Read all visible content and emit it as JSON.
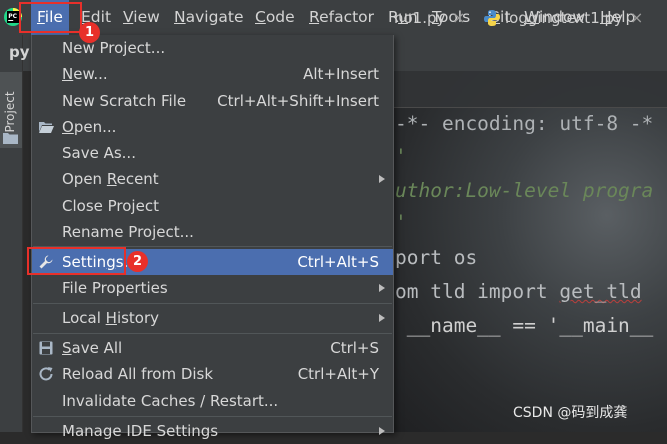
{
  "menubar": {
    "items": [
      {
        "pre": "",
        "mn": "F",
        "post": "ile"
      },
      {
        "pre": "",
        "mn": "E",
        "post": "dit"
      },
      {
        "pre": "",
        "mn": "V",
        "post": "iew"
      },
      {
        "pre": "",
        "mn": "N",
        "post": "avigate"
      },
      {
        "pre": "",
        "mn": "C",
        "post": "ode"
      },
      {
        "pre": "",
        "mn": "R",
        "post": "efactor"
      },
      {
        "pre": "R",
        "mn": "u",
        "post": "n"
      },
      {
        "pre": "",
        "mn": "T",
        "post": "ools"
      },
      {
        "pre": "",
        "mn": "G",
        "post": "it"
      },
      {
        "pre": "",
        "mn": "W",
        "post": "indow"
      },
      {
        "pre": "",
        "mn": "H",
        "post": "elp"
      }
    ]
  },
  "sidebar": {
    "project_label": "Project",
    "title_fragment": "py"
  },
  "editor": {
    "tabs": [
      {
        "label": "no1.py"
      },
      {
        "label": "loggingtext1.py"
      }
    ],
    "code": [
      {
        "a": "-*- encoding: utf-8 -*"
      },
      {
        "a": "'"
      },
      {
        "a": "uthor:Low-level progra"
      },
      {
        "a": "'"
      },
      {
        "a": "port os"
      },
      {
        "a": "om tld import ",
        "b": "get_tld"
      },
      {
        "a": " __name__ == '__main__"
      }
    ]
  },
  "file_menu": {
    "items": [
      {
        "pre": "New Project...",
        "mn": "",
        "post": "",
        "shortcut": ""
      },
      {
        "pre": "",
        "mn": "N",
        "post": "ew...",
        "shortcut": "Alt+Insert"
      },
      {
        "pre": "New Scratch File",
        "mn": "",
        "post": "",
        "shortcut": "Ctrl+Alt+Shift+Insert"
      },
      {
        "pre": "",
        "mn": "O",
        "post": "pen...",
        "shortcut": "",
        "icon": "folder-open-icon"
      },
      {
        "pre": "Save As...",
        "mn": "",
        "post": "",
        "shortcut": ""
      },
      {
        "pre": "Open ",
        "mn": "R",
        "post": "ecent",
        "shortcut": "",
        "submenu": true
      },
      {
        "pre": "Close Project",
        "mn": "",
        "post": "",
        "shortcut": ""
      },
      {
        "pre": "Rename Project...",
        "mn": "",
        "post": "",
        "shortcut": ""
      },
      {
        "pre": "Settin",
        "mn": "g",
        "post": "s...",
        "shortcut": "Ctrl+Alt+S",
        "icon": "wrench-icon",
        "highlighted": true
      },
      {
        "pre": "File Properties",
        "mn": "",
        "post": "",
        "shortcut": "",
        "submenu": true
      },
      {
        "pre": "Local ",
        "mn": "H",
        "post": "istory",
        "shortcut": "",
        "submenu": true
      },
      {
        "pre": "",
        "mn": "S",
        "post": "ave All",
        "shortcut": "Ctrl+S",
        "icon": "save-icon"
      },
      {
        "pre": "Reload All from Disk",
        "mn": "",
        "post": "",
        "shortcut": "Ctrl+Alt+Y",
        "icon": "reload-icon"
      },
      {
        "pre": "Invalidate Caches / Restart...",
        "mn": "",
        "post": "",
        "shortcut": ""
      },
      {
        "pre": "Manage IDE Settings",
        "mn": "",
        "post": "",
        "shortcut": "",
        "submenu": true
      }
    ]
  },
  "annotations": {
    "badge1": "1",
    "badge2": "2"
  },
  "watermark": "CSDN @码到成龚",
  "colors": {
    "accent": "#4b6eaf",
    "annotation_red": "#e8302a"
  }
}
